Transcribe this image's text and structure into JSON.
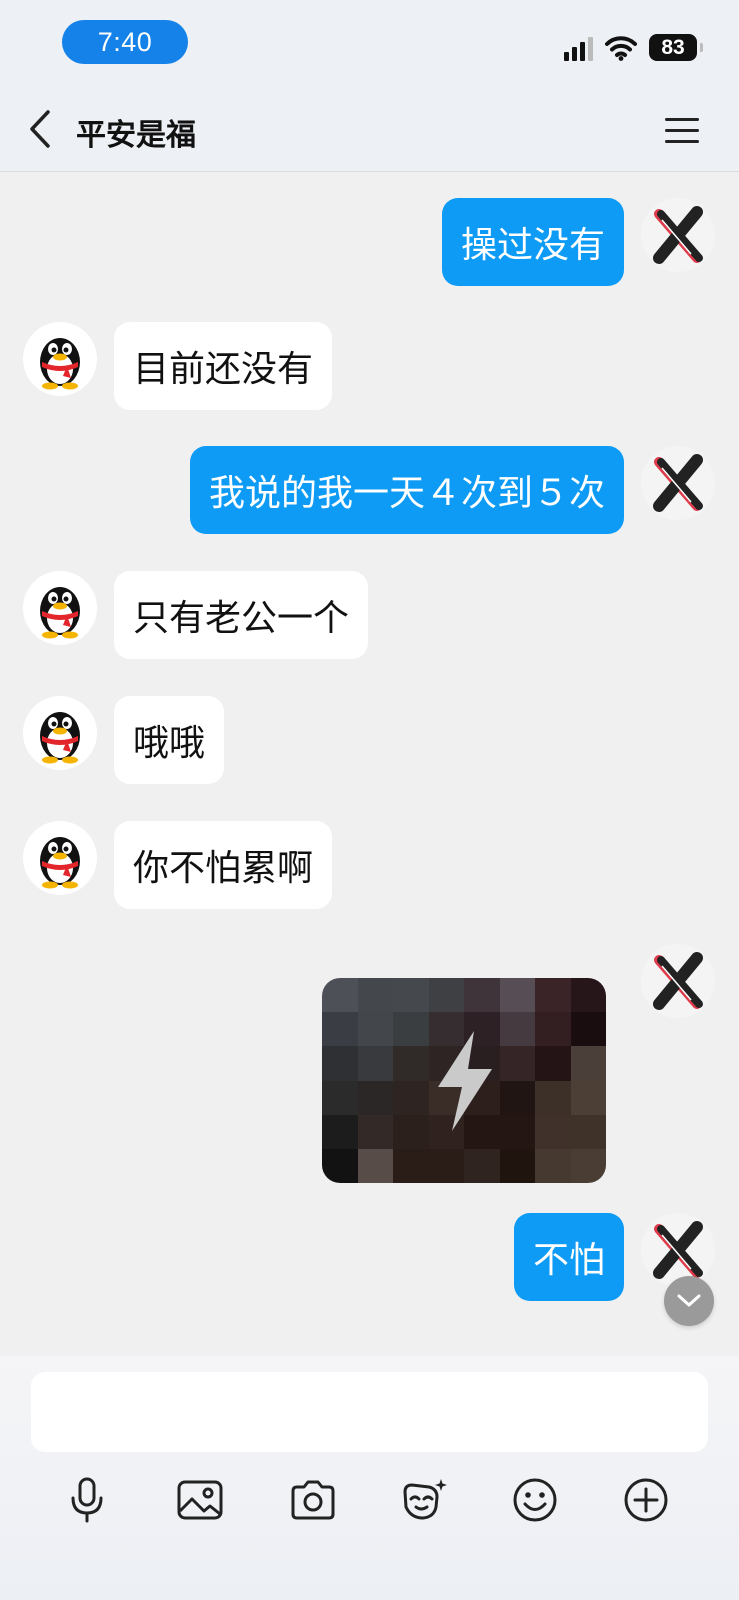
{
  "status_bar": {
    "time": "7:40",
    "battery": "83",
    "icons": [
      "cellular-signal-icon",
      "wifi-icon",
      "battery-icon"
    ]
  },
  "header": {
    "title": "平安是福",
    "back_icon": "chevron-left-icon",
    "menu_icon": "menu-icon"
  },
  "messages": [
    {
      "direction": "out",
      "text": "操过没有"
    },
    {
      "direction": "in",
      "text": "目前还没有"
    },
    {
      "direction": "out",
      "text": "我说的我一天４次到５次"
    },
    {
      "direction": "in",
      "text": "只有老公一个"
    },
    {
      "direction": "in",
      "text": "哦哦"
    },
    {
      "direction": "in",
      "text": "你不怕累啊"
    },
    {
      "direction": "out",
      "type": "image",
      "icon": "flash-icon"
    },
    {
      "direction": "out",
      "text": "不怕"
    }
  ],
  "colors": {
    "outgoing_bubble": "#0e9bf5",
    "incoming_bubble": "#ffffff",
    "time_pill": "#1482e8"
  },
  "input": {
    "value": "",
    "placeholder": ""
  },
  "toolbar": [
    "microphone-icon",
    "image-icon",
    "camera-icon",
    "sticker-icon",
    "emoji-icon",
    "add-icon"
  ]
}
